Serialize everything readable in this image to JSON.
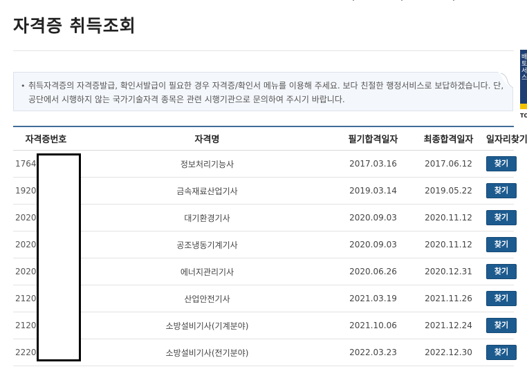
{
  "page": {
    "title": "자격증 취득조회"
  },
  "notice": {
    "text": "취득자격증의 자격증발급, 확인서발급이 필요한 경우 자격증/확인서 메뉴를 이용해 주세요. 보다 친절한 행정서비스로 보답하겠습니다. 단, 공단에서 시행하지 않는 국가기술자격 종목은 관련 시행기관으로 문의하여 주시기 바랍니다."
  },
  "side_banner": {
    "text": "배 토 서 스",
    "bottom_label": "TO"
  },
  "table": {
    "headers": [
      "자격증번호",
      "자격명",
      "필기합격일자",
      "최종합격일자",
      "일자리찾기"
    ],
    "button_label": "찾기",
    "rows": [
      {
        "number": "17641",
        "name": "정보처리기능사",
        "written_pass": "2017.03.16",
        "final_pass": "2017.06.12"
      },
      {
        "number": "19201",
        "name": "금속재료산업기사",
        "written_pass": "2019.03.14",
        "final_pass": "2019.05.22"
      },
      {
        "number": "20203",
        "name": "대기환경기사",
        "written_pass": "2020.09.03",
        "final_pass": "2020.11.12"
      },
      {
        "number": "20203",
        "name": "공조냉동기계기사",
        "written_pass": "2020.09.03",
        "final_pass": "2020.11.12"
      },
      {
        "number": "20204",
        "name": "에너지관리기사",
        "written_pass": "2020.06.26",
        "final_pass": "2020.12.31"
      },
      {
        "number": "21203",
        "name": "산업안전기사",
        "written_pass": "2021.03.19",
        "final_pass": "2021.11.26"
      },
      {
        "number": "21204",
        "name": "소방설비기사(기계분야)",
        "written_pass": "2021.10.06",
        "final_pass": "2021.12.24"
      },
      {
        "number": "22204",
        "name": "소방설비기사(전기분야)",
        "written_pass": "2022.03.23",
        "final_pass": "2022.12.30"
      }
    ]
  }
}
